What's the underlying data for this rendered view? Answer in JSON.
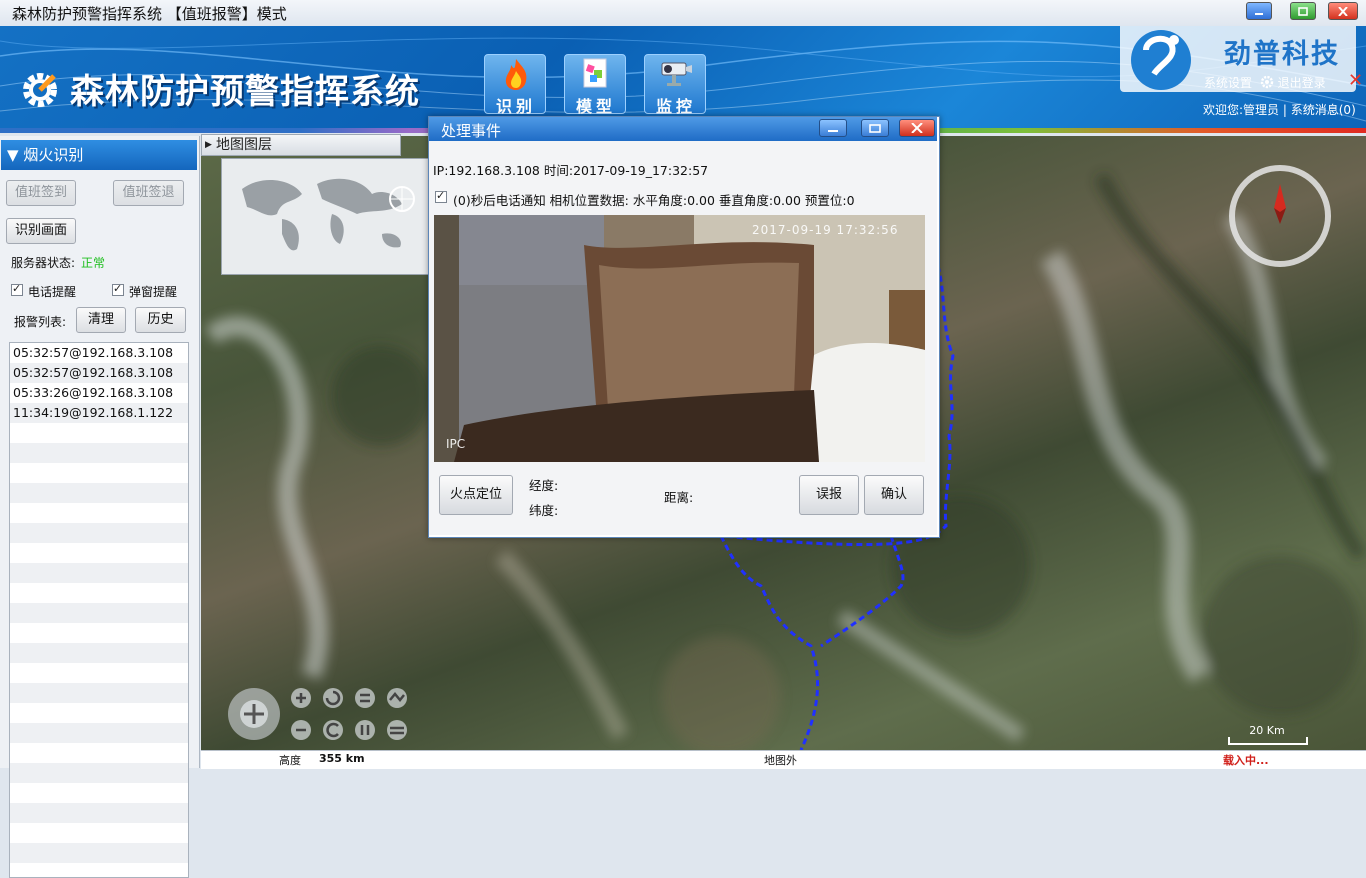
{
  "window": {
    "title": "森林防护预警指挥系统 【值班报警】模式"
  },
  "header": {
    "app_title": "森林防护预警指挥系统",
    "nav": [
      {
        "label": "识别",
        "icon": "flame-icon"
      },
      {
        "label": "模型",
        "icon": "model-icon"
      },
      {
        "label": "监控",
        "icon": "camera-icon"
      }
    ],
    "brand_name": "劲普科技",
    "links": {
      "settings": "系统设置",
      "logout": "退出登录"
    },
    "welcome": "欢迎您:管理员",
    "separator": "|",
    "messages": "系统消息(0)"
  },
  "left_panel": {
    "title": "烟火识别",
    "buttons": {
      "check_in": "值班签到",
      "check_out": "值班签退",
      "recognize_view": "识别画面",
      "clear": "清理",
      "history": "历史"
    },
    "server_status_label": "服务器状态:",
    "server_status_value": "正常",
    "phone_alert": "电话提醒",
    "popup_alert": "弹窗提醒",
    "alarm_list_label": "报警列表:",
    "alarms": [
      "05:32:57@192.168.3.108",
      "05:32:57@192.168.3.108",
      "05:33:26@192.168.3.108",
      "11:34:19@192.168.1.122"
    ]
  },
  "map": {
    "layers_tab": "地图图层",
    "scale_label": "20 Km",
    "status": {
      "altitude_label": "高度",
      "altitude_value": "355 km",
      "location": "地图外",
      "loading": "载入中..."
    }
  },
  "dialog": {
    "title": "处理事件",
    "info": "IP:192.168.3.108 时间:2017-09-19_17:32:57",
    "option_text": "(0)秒后电话通知 相机位置数据:  水平角度:0.00 垂直角度:0.00 预置位:0",
    "video_timestamp": "2017-09-19 17:32:56",
    "video_watermark": "IPC",
    "buttons": {
      "locate": "火点定位",
      "false_alarm": "误报",
      "confirm": "确认"
    },
    "longitude_label": "经度:",
    "latitude_label": "纬度:",
    "distance_label": "距离:"
  },
  "colors": {
    "header_blue": "#1471c4",
    "status_ok": "#1fbf1f",
    "loading_red": "#d0201a"
  }
}
